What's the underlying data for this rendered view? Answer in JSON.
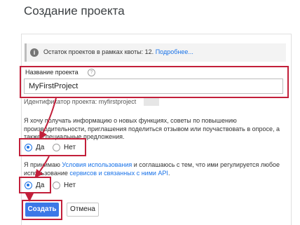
{
  "page": {
    "title": "Создание проекта"
  },
  "notice": {
    "text": "Остаток проектов в рамках квоты: 12.",
    "link": "Подробнее..."
  },
  "project_name": {
    "label": "Название проекта",
    "value": "MyFirstProject",
    "id_label": "Идентификатор проекта: myfirstproject"
  },
  "updates": {
    "question": "Я хочу получать информацию о новых функциях, советы по повышению производительности, приглашения поделиться отзывом или поучаствовать в опросе, а также специальные предложения.",
    "yes": "Да",
    "no": "Нет",
    "selected": "Да"
  },
  "terms": {
    "prefix": "Я принимаю ",
    "link1": "Условия использования",
    "middle": " и соглашаюсь с тем, что ими регулируется любое использование ",
    "link2": "сервисов и связанных с ними API",
    "suffix": ".",
    "yes": "Да",
    "no": "Нет",
    "selected": "Да"
  },
  "buttons": {
    "create": "Создать",
    "cancel": "Отмена"
  },
  "colors": {
    "accent": "#1a73e8",
    "primary_button": "#3b78e7",
    "highlight": "#c21f3a"
  }
}
